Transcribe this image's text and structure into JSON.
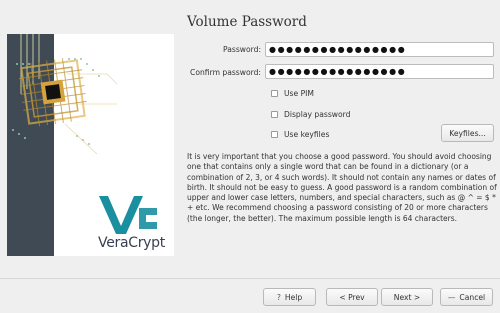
{
  "dialog": {
    "title": "Volume Password",
    "password_label": "Password:",
    "password_value": "●●●●●●●●●●●●●●●●",
    "confirm_label": "Confirm password:",
    "confirm_value": "●●●●●●●●●●●●●●●●",
    "options": {
      "use_pim": "Use PIM",
      "display_password": "Display password",
      "use_keyfiles": "Use keyfiles"
    },
    "keyfiles_button": "Keyfiles...",
    "info_text": "It is very important that you choose a good password. You should avoid choosing one that contains only a single word that can be found in a dictionary (or a combination of 2, 3, or 4 such words). It should not contain any names or dates of birth. It should not be easy to guess. A good password is a random combination of upper and lower case letters, numbers, and special characters, such as @ ^ = $ * + etc. We recommend choosing a password consisting of 20 or more characters (the longer, the better). The maximum possible length is 64 characters."
  },
  "brand": {
    "name": "VeraCrypt",
    "accent": "#1a8fa0"
  },
  "footer": {
    "help": "Help",
    "prev": "< Prev",
    "next": "Next >",
    "cancel": "Cancel"
  },
  "icons": {
    "help": "?",
    "cancel": "—"
  }
}
